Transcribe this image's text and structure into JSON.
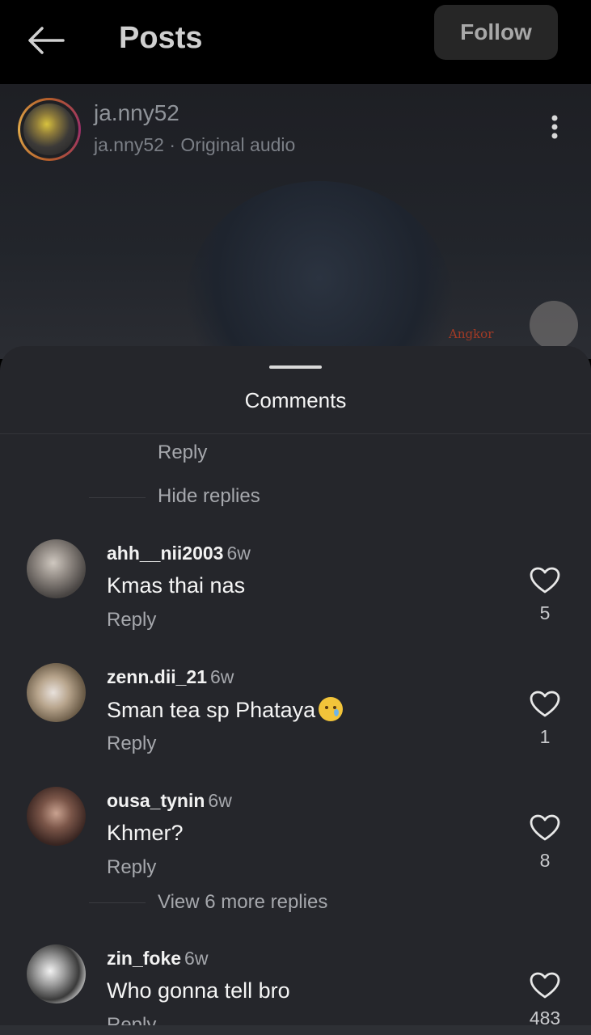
{
  "header": {
    "title": "Posts",
    "follow_label": "Follow"
  },
  "post": {
    "author_username": "ja.nny52",
    "author_subtitle": "ja.nny52 · Original audio",
    "background_sign_text": "Angkor"
  },
  "comments_sheet": {
    "title": "Comments",
    "partial_reply_label": "Reply",
    "hide_replies_label": "Hide replies",
    "view_more_label": "View 6 more replies",
    "items": [
      {
        "username": "ahh__nii2003",
        "time": "6w",
        "text": "Kmas thai nas",
        "reply_label": "Reply",
        "likes": "5"
      },
      {
        "username": "zenn.dii_21",
        "time": "6w",
        "text": "Sman tea sp Phataya",
        "emoji": "crying-face",
        "reply_label": "Reply",
        "likes": "1"
      },
      {
        "username": "ousa_tynin",
        "time": "6w",
        "text": "Khmer?",
        "reply_label": "Reply",
        "likes": "8"
      },
      {
        "username": "zin_foke",
        "time": "6w",
        "text": "Who gonna tell bro",
        "reply_label": "Reply",
        "likes": "483"
      }
    ]
  },
  "colors": {
    "sheet_bg": "#25262b",
    "topbar_bg": "#000000",
    "follow_bg": "#262626",
    "muted_text": "#a6a8ad"
  }
}
